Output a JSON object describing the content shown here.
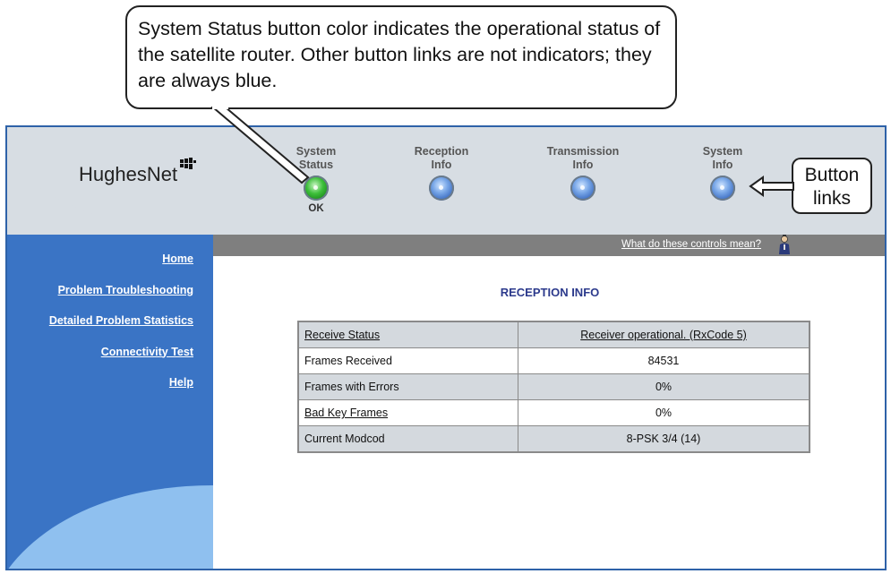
{
  "callout": {
    "text": "System Status button color indicates the operational status of the satellite router. Other button links are not indicators; they are always blue."
  },
  "annotation": {
    "line1": "Button",
    "line2": "links"
  },
  "logo": {
    "text": "HughesNet",
    "icon": "hughesnet-logo-mark"
  },
  "nav": [
    {
      "label": "System\nStatus",
      "orb_color": "green",
      "status": "OK"
    },
    {
      "label": "Reception\nInfo",
      "orb_color": "blue"
    },
    {
      "label": "Transmission\nInfo",
      "orb_color": "blue"
    },
    {
      "label": "System\nInfo",
      "orb_color": "blue"
    }
  ],
  "greybar": {
    "link": "What do these controls mean?",
    "icon": "person-icon"
  },
  "sidebar": {
    "links": [
      "Home",
      "Problem Troubleshooting",
      "Detailed Problem Statistics",
      "Connectivity Test",
      "Help"
    ]
  },
  "main": {
    "title": "RECEPTION INFO",
    "table": [
      {
        "label": "Receive Status",
        "value": "Receiver operational. (RxCode 5)"
      },
      {
        "label": "Frames Received",
        "value": "84531"
      },
      {
        "label": "Frames with Errors",
        "value": "0%"
      },
      {
        "label": "Bad Key Frames",
        "value": "0%"
      },
      {
        "label": "Current Modcod",
        "value": "8-PSK 3/4 (14)"
      }
    ]
  },
  "colors": {
    "sidebar": "#3a74c5",
    "header": "#d7dde3",
    "greybar": "#7f7f7f",
    "title": "#2c3a8c"
  }
}
